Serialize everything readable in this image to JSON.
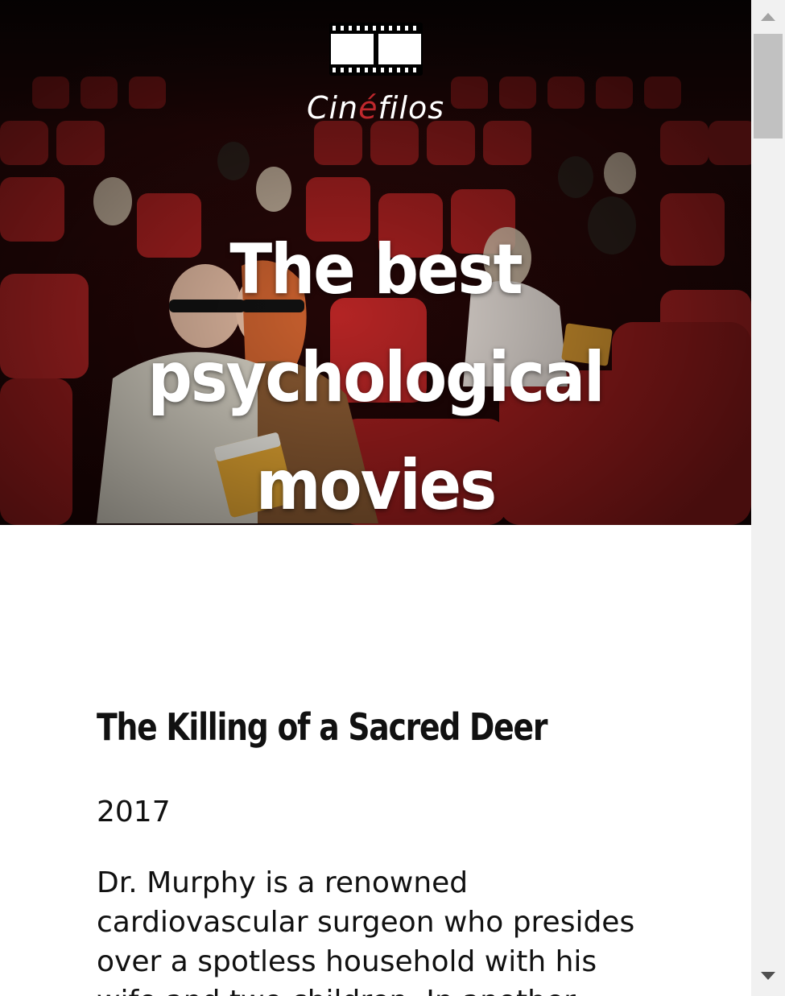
{
  "site": {
    "logo_text_before": "Cin",
    "logo_text_accent": "é",
    "logo_text_after": "filos",
    "accent_color": "#c0282d"
  },
  "hero": {
    "title": "The best psychological movies",
    "background": "cinema-audience-3d-glasses-photo"
  },
  "movies": [
    {
      "title": "The Killing of a Sacred Deer",
      "year": "2017",
      "description": "Dr. Murphy is a renowned cardiovascular surgeon who presides over a spotless household with his wife and two children. In another"
    }
  ],
  "icons": {
    "logo": "film-strip-icon",
    "scroll_up": "scroll-up-arrow-icon",
    "scroll_down": "scroll-down-arrow-icon"
  }
}
